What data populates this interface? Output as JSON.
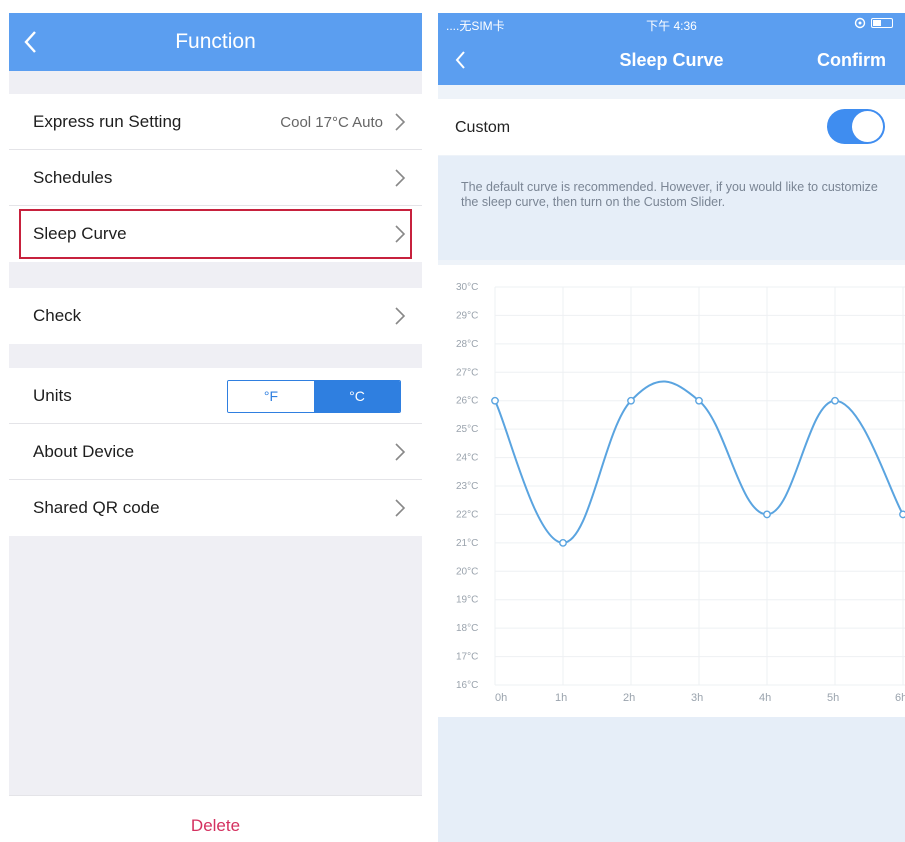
{
  "function_screen": {
    "title": "Function",
    "group1": [
      {
        "label": "Express run Setting",
        "value": "Cool 17°C Auto"
      },
      {
        "label": "Schedules",
        "value": ""
      },
      {
        "label": "Sleep Curve",
        "value": ""
      }
    ],
    "group2": [
      {
        "label": "Check",
        "value": ""
      }
    ],
    "group3": {
      "units_label": "Units",
      "unit_f": "°F",
      "unit_c": "°C",
      "selected_unit": "°C",
      "rows": [
        {
          "label": "About Device",
          "value": ""
        },
        {
          "label": "Shared QR code",
          "value": ""
        }
      ]
    },
    "delete_label": "Delete"
  },
  "sleep_screen": {
    "status": {
      "carrier": "....无SIM卡",
      "time": "下午 4:36"
    },
    "title": "Sleep Curve",
    "confirm_label": "Confirm",
    "custom_label": "Custom",
    "custom_enabled": true,
    "hint": "The default curve is recommended. However, if you would like to customize the sleep curve, then turn on the Custom Slider."
  },
  "colors": {
    "nav_blue": "#5b9ef0",
    "accent_blue": "#2f7fe0",
    "highlight_red": "#c7213d",
    "delete_pink": "#d4305f",
    "curve_blue": "#5aa4e0"
  },
  "chart_data": {
    "type": "line",
    "x": [
      "0h",
      "1h",
      "2h",
      "3h",
      "4h",
      "5h",
      "6h"
    ],
    "values": [
      26,
      21,
      26,
      26,
      22,
      26,
      22
    ],
    "yticks": [
      "16°C",
      "17°C",
      "18°C",
      "19°C",
      "20°C",
      "21°C",
      "22°C",
      "23°C",
      "24°C",
      "25°C",
      "26°C",
      "27°C",
      "28°C",
      "29°C",
      "30°C"
    ],
    "ylim": [
      16,
      30
    ],
    "grid": true,
    "smooth": true,
    "xlabel": "",
    "ylabel": ""
  }
}
